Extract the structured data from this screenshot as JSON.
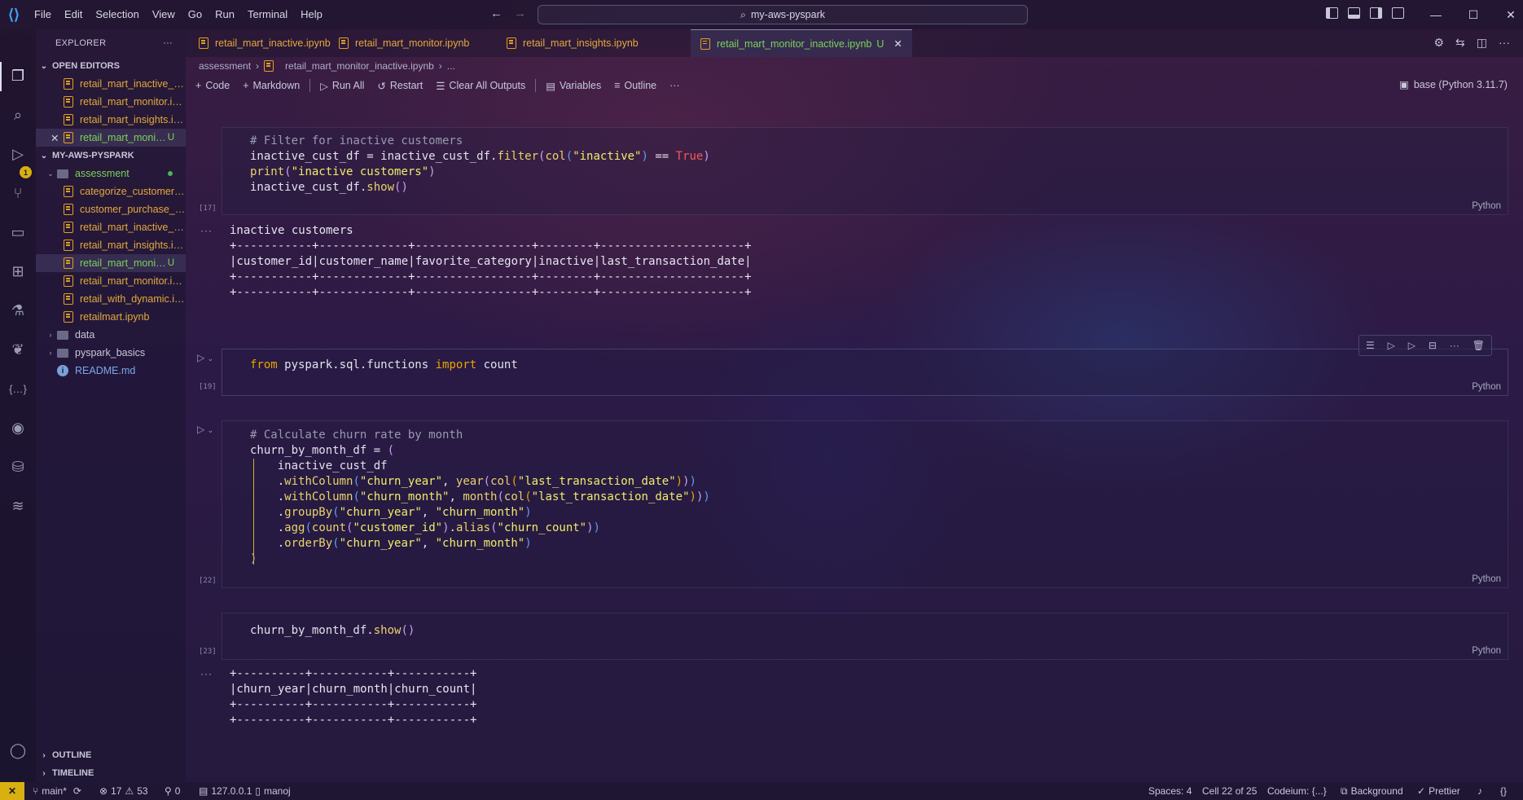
{
  "titlebar": {
    "menus": [
      "File",
      "Edit",
      "Selection",
      "View",
      "Go",
      "Run",
      "Terminal",
      "Help"
    ],
    "search": "my-aws-pyspark"
  },
  "sidebar": {
    "title": "EXPLORER",
    "open_editors_label": "OPEN EDITORS",
    "open_editors": [
      {
        "name": "retail_mart_inactive_customers.ipynb",
        "badge": ""
      },
      {
        "name": "retail_mart_monitor.ipynb",
        "badge": ""
      },
      {
        "name": "retail_mart_insights.ipynb",
        "badge": ""
      },
      {
        "name": "retail_mart_monitor_inactive.ipynb",
        "badge": "U"
      }
    ],
    "workspace_label": "MY-AWS-PYSPARK",
    "folder_assessment": "assessment",
    "assessment_files": [
      {
        "name": "categorize_customers.ipynb",
        "badge": ""
      },
      {
        "name": "customer_purchase_analysis.ipynb",
        "badge": ""
      },
      {
        "name": "retail_mart_inactive_customers.ipynb",
        "badge": ""
      },
      {
        "name": "retail_mart_insights.ipynb",
        "badge": ""
      },
      {
        "name": "retail_mart_monitor_inactive.ipynb",
        "badge": "U"
      },
      {
        "name": "retail_mart_monitor.ipynb",
        "badge": ""
      },
      {
        "name": "retail_with_dynamic.ipynb",
        "badge": ""
      },
      {
        "name": "retailmart.ipynb",
        "badge": ""
      }
    ],
    "folder_data": "data",
    "folder_pyspark": "pyspark_basics",
    "readme": "README.md",
    "outline_label": "OUTLINE",
    "timeline_label": "TIMELINE"
  },
  "tabs": [
    {
      "label": "retail_mart_inactive.ipynb"
    },
    {
      "label": "retail_mart_monitor.ipynb"
    },
    {
      "label": "retail_mart_insights.ipynb"
    },
    {
      "label": "retail_mart_monitor_inactive.ipynb",
      "badge": "U"
    }
  ],
  "breadcrumb": {
    "folder": "assessment",
    "file": "retail_mart_monitor_inactive.ipynb",
    "more": "..."
  },
  "toolbar": {
    "code": "Code",
    "markdown": "Markdown",
    "run_all": "Run All",
    "restart": "Restart",
    "clear": "Clear All Outputs",
    "variables": "Variables",
    "outline": "Outline",
    "more": "···"
  },
  "kernel": "base (Python 3.11.7)",
  "cells": {
    "c17": {
      "exec": "[17]",
      "lang": "Python"
    },
    "out17": {
      "line1": "inactive customers",
      "line2": "+-----------+-------------+-----------------+--------+---------------------+",
      "line3": "|customer_id|customer_name|favorite_category|inactive|last_transaction_date|",
      "line4": "+-----------+-------------+-----------------+--------+---------------------+",
      "line5": "+-----------+-------------+-----------------+--------+---------------------+"
    },
    "c19": {
      "exec": "[19]",
      "lang": "Python"
    },
    "c22": {
      "exec": "[22]",
      "lang": "Python"
    },
    "c23": {
      "exec": "[23]",
      "lang": "Python"
    },
    "out23": {
      "line1": "+----------+-----------+-----------+",
      "line2": "|churn_year|churn_month|churn_count|",
      "line3": "+----------+-----------+-----------+",
      "line4": "+----------+-----------+-----------+"
    }
  },
  "statusbar": {
    "branch": "main*",
    "errors": "17",
    "warnings": "53",
    "ports": "0",
    "server": "127.0.0.1",
    "user": "manoj",
    "spaces": "Spaces: 4",
    "cell": "Cell 22 of 25",
    "codeium": "Codeium: {...}",
    "background": "Background",
    "prettier": "Prettier"
  },
  "colors": {
    "accent_yellow": "#d8b012",
    "modified_green": "#7ad35a",
    "notebook_orange": "#e3a93a"
  }
}
